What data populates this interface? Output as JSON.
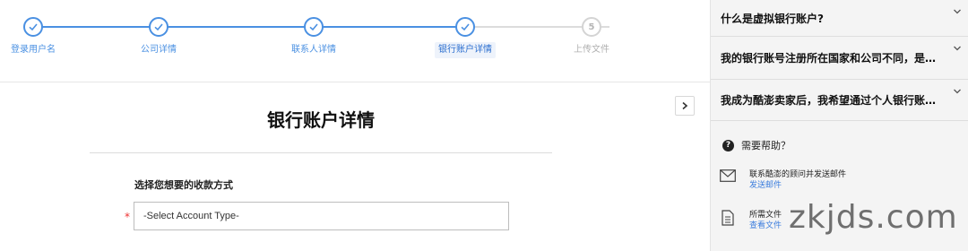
{
  "colors": {
    "accent": "#4a90e2",
    "required": "#e33333",
    "sidebar_bg": "#f4f4f4",
    "link": "#3b7ddd"
  },
  "stepper": {
    "steps": [
      {
        "label": "登录用户名",
        "status": "done"
      },
      {
        "label": "公司详情",
        "status": "done"
      },
      {
        "label": "联系人详情",
        "status": "done"
      },
      {
        "label": "银行账户详情",
        "status": "active"
      },
      {
        "label": "上传文件",
        "status": "pending",
        "number": "5"
      }
    ]
  },
  "form": {
    "title": "银行账户详情",
    "field_label": "选择您想要的收款方式",
    "required_mark": "*",
    "select_value": "-Select Account Type-"
  },
  "sidebar": {
    "faqs": [
      {
        "question": "什么是虚拟银行账户?"
      },
      {
        "question": "我的银行账号注册所在国家和公司不同，是否可以使用？"
      },
      {
        "question": "我成为酷澎卖家后，我希望通过个人银行账户收款"
      }
    ],
    "help": {
      "heading": "需要帮助？",
      "icon_glyph": "?",
      "email": {
        "title": "联系酷澎的顾问并发送邮件",
        "link": "发送邮件",
        "icon": "envelope-icon"
      },
      "docs": {
        "title": "所需文件",
        "link": "查看文件",
        "icon": "document-icon"
      }
    }
  },
  "watermark": "zkjds.com"
}
